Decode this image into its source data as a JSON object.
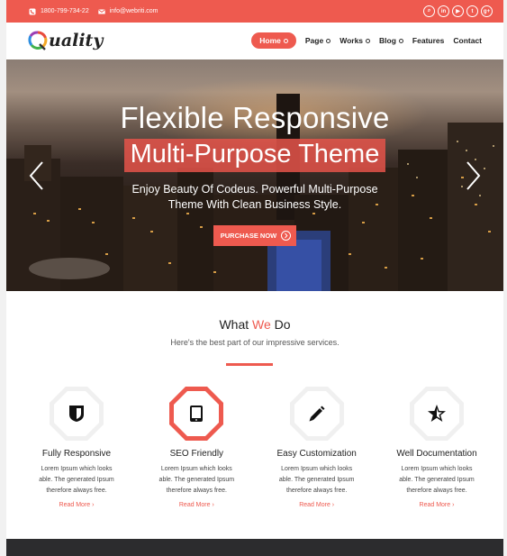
{
  "topbar": {
    "phone": "1800-799-734-22",
    "email": "info@webriti.com",
    "social": [
      {
        "name": "search",
        "glyph": "⌕"
      },
      {
        "name": "linkedin",
        "glyph": "in"
      },
      {
        "name": "youtube",
        "glyph": "▶"
      },
      {
        "name": "twitter",
        "glyph": "t"
      },
      {
        "name": "google-plus",
        "glyph": "g+"
      }
    ]
  },
  "nav": {
    "logo": "uality",
    "items": [
      "Home",
      "Page",
      "Works",
      "Blog",
      "Features",
      "Contact"
    ]
  },
  "hero": {
    "title": "Flexible Responsive",
    "highlight": "Multi-Purpose Theme",
    "subtitle_line1": "Enjoy Beauty Of Codeus. Powerful Multi-Purpose",
    "subtitle_line2": "Theme With Clean Business Style.",
    "button": "PURCHASE NOW"
  },
  "section": {
    "title_pre": "What ",
    "title_accent": "We",
    "title_post": " Do",
    "subtitle": "Here's the best part of our impressive services."
  },
  "services": [
    {
      "title": "Fully Responsive",
      "l1": "Lorem Ipsum which looks",
      "l2": "able. The generated Ipsum",
      "l3": "therefore always free.",
      "more": "Read More ›",
      "icon": "shield-icon"
    },
    {
      "title": "SEO Friendly",
      "l1": "Lorem Ipsum which looks",
      "l2": "able. The generated Ipsum",
      "l3": "therefore always free.",
      "more": "Read More ›",
      "icon": "tablet-icon"
    },
    {
      "title": "Easy Customization",
      "l1": "Lorem Ipsum which looks",
      "l2": "able. The generated Ipsum",
      "l3": "therefore always free.",
      "more": "Read More ›",
      "icon": "pencil-icon"
    },
    {
      "title": "Well Documentation",
      "l1": "Lorem Ipsum which looks",
      "l2": "able. The generated Ipsum",
      "l3": "therefore always free.",
      "more": "Read More ›",
      "icon": "star-icon"
    }
  ],
  "colors": {
    "accent": "#ee5a4f",
    "dark": "#2c2c2e",
    "text": "#222222"
  }
}
